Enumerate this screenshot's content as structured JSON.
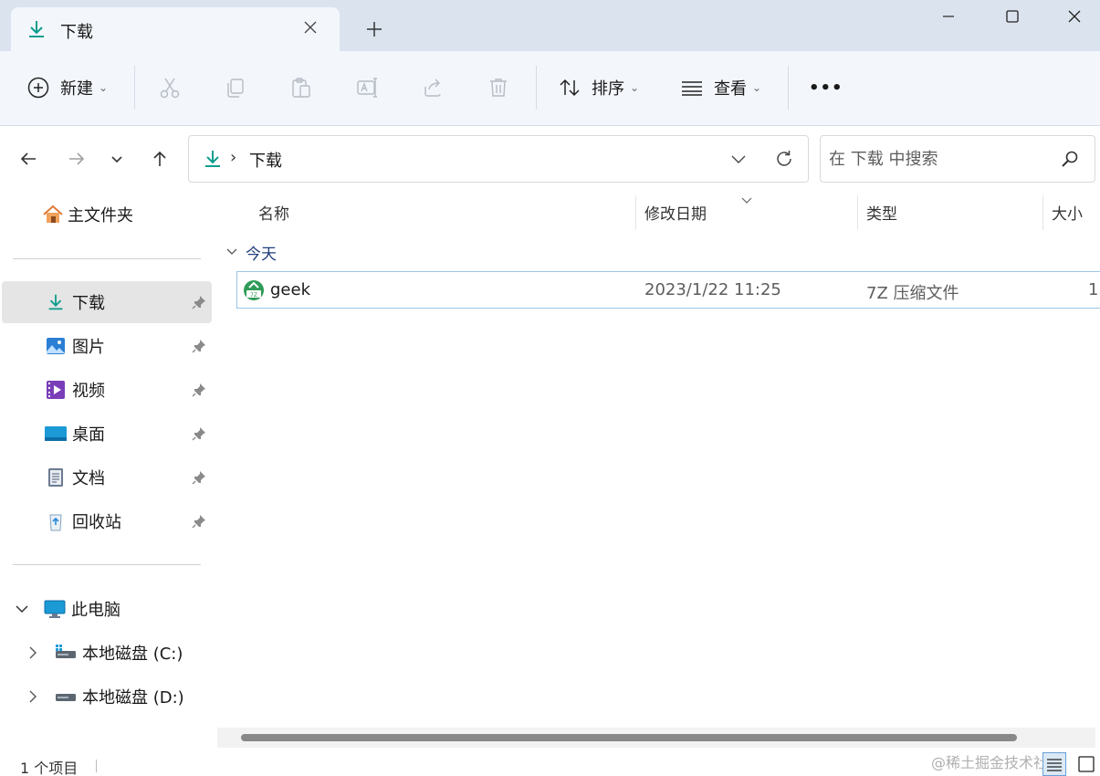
{
  "tab": {
    "title": "下载",
    "new_tab_symbol": "+"
  },
  "toolbar": {
    "new_label": "新建",
    "sort_label": "排序",
    "view_label": "查看",
    "more_symbol": "•••",
    "caret": "⌄",
    "icons": [
      "cut-icon",
      "copy-icon",
      "paste-icon",
      "rename-icon",
      "share-icon",
      "delete-icon"
    ]
  },
  "address": {
    "separator": "›",
    "folder": "下载"
  },
  "search": {
    "placeholder": "在 下载 中搜索"
  },
  "sidebar": {
    "home": "主文件夹",
    "quick_access": [
      {
        "label": "下载",
        "icon": "download-icon",
        "pinned": true,
        "selected": true
      },
      {
        "label": "图片",
        "icon": "pictures-icon",
        "pinned": true
      },
      {
        "label": "视频",
        "icon": "videos-icon",
        "pinned": true
      },
      {
        "label": "桌面",
        "icon": "desktop-icon",
        "pinned": true
      },
      {
        "label": "文档",
        "icon": "documents-icon",
        "pinned": true
      },
      {
        "label": "回收站",
        "icon": "recycle-bin-icon",
        "pinned": true
      }
    ],
    "this_pc": "此电脑",
    "drives": [
      {
        "label": "本地磁盘 (C:)",
        "icon": "drive-c-icon"
      },
      {
        "label": "本地磁盘 (D:)",
        "icon": "drive-d-icon"
      }
    ]
  },
  "columns": {
    "name": "名称",
    "modified": "修改日期",
    "type": "类型",
    "size": "大小"
  },
  "group": {
    "label": "今天"
  },
  "files": [
    {
      "name": "geek",
      "modified": "2023/1/22 11:25",
      "type": "7Z 压缩文件",
      "size": "1,"
    }
  ],
  "status": {
    "item_count": "1 个项目",
    "watermark": "@稀土掘金技术社区"
  },
  "colors": {
    "accent": "#0f9d8f",
    "selection_border": "#99c6e8",
    "group_text": "#1f3d7a"
  }
}
